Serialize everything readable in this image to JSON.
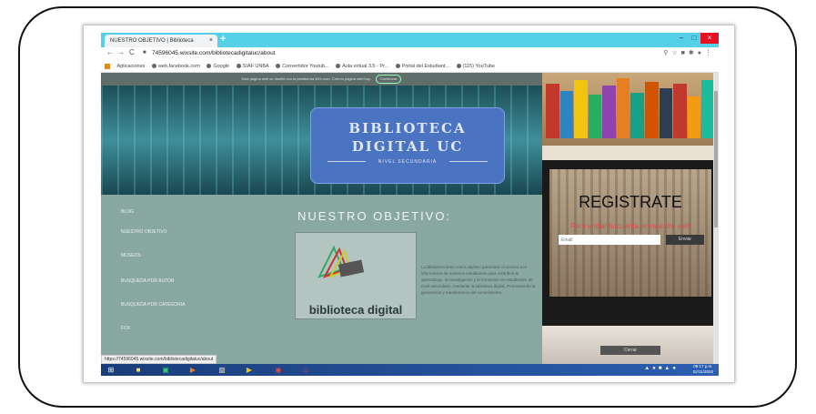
{
  "browser": {
    "tab_title": "NUESTRO OBJETIVO | Biblioteca",
    "tab_close": "×",
    "new_tab": "+",
    "url": "74596045.wixsite.com/bibliotecadigitaluc/about",
    "status_url": "https://74596045.wixsite.com/bibliotecadigitaluc/about",
    "window_controls": {
      "minimize": "–",
      "maximize": "□",
      "close": "×"
    },
    "nav": {
      "back": "←",
      "forward": "→",
      "reload": "C"
    },
    "bookmarks": [
      "Aplicaciones",
      "web.facebook.com",
      "Google",
      "SIAF UNBA",
      "Convertidor Youtub...",
      "Aula virtual 3.5 - Pr...",
      "Portal del Estudiant...",
      "(115) YouTube"
    ]
  },
  "wix_bar": {
    "text": "Esta página web se diseñó con la plataforma WIX.com. Crea tu página web hoy.",
    "button": "Comenzar"
  },
  "banner": {
    "line1": "BIBLIOTECA",
    "line2": "DIGITAL UC",
    "subtitle": "NIVEL SECUNDARIA"
  },
  "sidebar": {
    "items": [
      "BLOG",
      "NUESTRO OBJETIVO",
      "MUSEOS",
      "BUSQUEDA POR AUTOR",
      "BUSQUEDA POR CATEGORIA",
      "FOX"
    ]
  },
  "main": {
    "heading": "NUESTRO OBJETIVO:",
    "logo_text": "biblioteca digital",
    "description": "La Biblioteca tiene como objetivo garantizar el acceso a la información de nuestros estudiantes para contribuir al aprendizaje, la investigación y la formación de estudiantes de nivel secundario, mediante la biblioteca digital. Promoviendo la generación y transferencia del conocimiento."
  },
  "popup": {
    "title": "REGISTRATE",
    "subtitle": "Para entrar tu cuenta en nuestra web",
    "email_placeholder": "Email",
    "send_label": "Enviar",
    "close_label": "Cerrar"
  },
  "taskbar": {
    "time": "09:17 p.m.",
    "date": "02/11/2020"
  },
  "colors": {
    "tabstrip": "#54d0e8",
    "banner_box": "#4a73c2",
    "close_red": "#e81123"
  }
}
